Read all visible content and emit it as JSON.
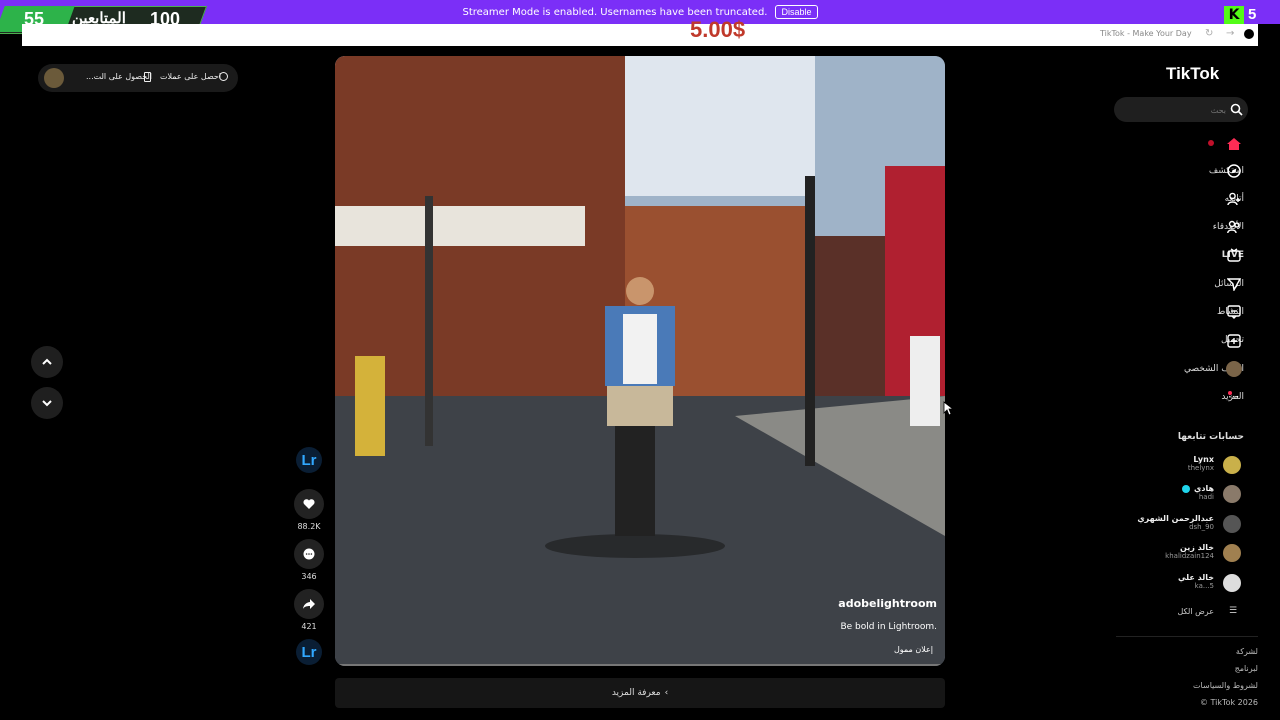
{
  "stream_overlay": {
    "followers_count": "55",
    "followers_label": "المتابعين",
    "followers_goal": "100",
    "streamer_message": "Streamer Mode is enabled. Usernames have been truncated.",
    "disable_label": "Disable",
    "price_text": "5.00$",
    "kick_logo": "K",
    "kick_count": "5"
  },
  "browser": {
    "tab_title": "TikTok - Make Your Day"
  },
  "top_left": {
    "get_coins": "احصل على عملات",
    "get_app": "الحصول على الت..."
  },
  "sidebar": {
    "logo": "TikTok",
    "search_placeholder": "بحث",
    "nav": [
      {
        "label": "",
        "icon": "home-icon"
      },
      {
        "label": "استكشف",
        "icon": "compass-icon"
      },
      {
        "label": "أتابعه",
        "icon": "user-plus-icon"
      },
      {
        "label": "الأصدقاء",
        "icon": "friends-icon"
      },
      {
        "label": "LIVE",
        "icon": "live-icon"
      },
      {
        "label": "الرسائل",
        "icon": "send-icon"
      },
      {
        "label": "النشاط",
        "icon": "activity-icon"
      },
      {
        "label": "تحميل",
        "icon": "upload-icon"
      },
      {
        "label": "الملف الشخصي",
        "icon": "avatar-icon"
      },
      {
        "label": "المزيد",
        "icon": "more-icon"
      }
    ],
    "following_heading": "حسابات تتابعها",
    "following": [
      {
        "name": "Lynx",
        "handle": "thelynx",
        "color": "#c9b04a"
      },
      {
        "name": "هادي",
        "handle": "hadi",
        "color": "#8a7a6a"
      },
      {
        "name": "عبدالرحمن الشهري",
        "handle": "dsh_90",
        "color": "#555555"
      },
      {
        "name": "خالد زين",
        "handle": "khalidzain124",
        "color": "#a08050"
      },
      {
        "name": "خالد علي",
        "handle": "ka...5",
        "color": "#dddddd"
      }
    ],
    "see_all": "عرض الكل",
    "footer": [
      "لشركة",
      "لبرنامج",
      "لشروط والسياسات",
      "© TikTok 2026"
    ]
  },
  "video": {
    "author": "adobelightroom",
    "caption": "Be bold in Lightroom.",
    "sponsored": "إعلان ممول",
    "see_more": "معرفة المزيد"
  },
  "actions": {
    "brand_badge": "Lr",
    "likes": "88.2K",
    "comments": "346",
    "shares": "421"
  }
}
